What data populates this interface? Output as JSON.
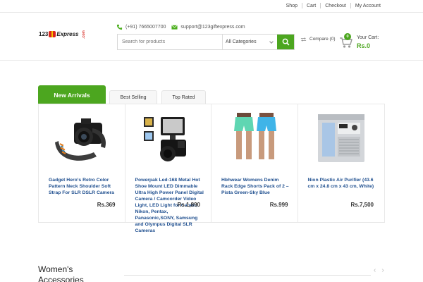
{
  "topbar": {
    "links": [
      "Shop",
      "Cart",
      "Checkout",
      "My Account"
    ]
  },
  "header": {
    "logo": {
      "num": "123",
      "brand": "Express",
      "com": ".com"
    },
    "phone": "(+91) 7665007700",
    "email": "support@123giftexpress.com",
    "search": {
      "placeholder": "Search for products",
      "category": "All Categories"
    },
    "compare": "Compare (0)",
    "cart": {
      "label": "Your Cart:",
      "count": "0",
      "amount": "Rs.0"
    }
  },
  "tabs": [
    "New Arrivals",
    "Best Selling",
    "Top Rated"
  ],
  "products": [
    {
      "name": "Gadget Hero's Retro Color Pattern Neck Shoulder Soft Strap For SLR DSLR Camera",
      "price": "Rs.369"
    },
    {
      "name": "Powerpak Led-168 Metal Hot Shoe Mount LED Dimmable Ultra High Power Panel Digital Camera / Camcorder Video Light, LED Light for Canon, Nikon, Pentax, Panasonic,SONY, Samsung and Olympus Digital SLR Cameras",
      "price": "Rs.1,890"
    },
    {
      "name": "Hbhwear Womens Denim Rack Edge Shorts Pack of 2 – Pista Green-Sky Blue",
      "price": "Rs.999"
    },
    {
      "name": "Nion Plastic Air Purifier (43.6 cm x 24.8 cm x 43 cm, White)",
      "price": "Rs.7,500"
    }
  ],
  "section": {
    "title": "Women's Accessories"
  },
  "colors": {
    "accent": "#4ca61f",
    "link": "#1f4f8f"
  }
}
